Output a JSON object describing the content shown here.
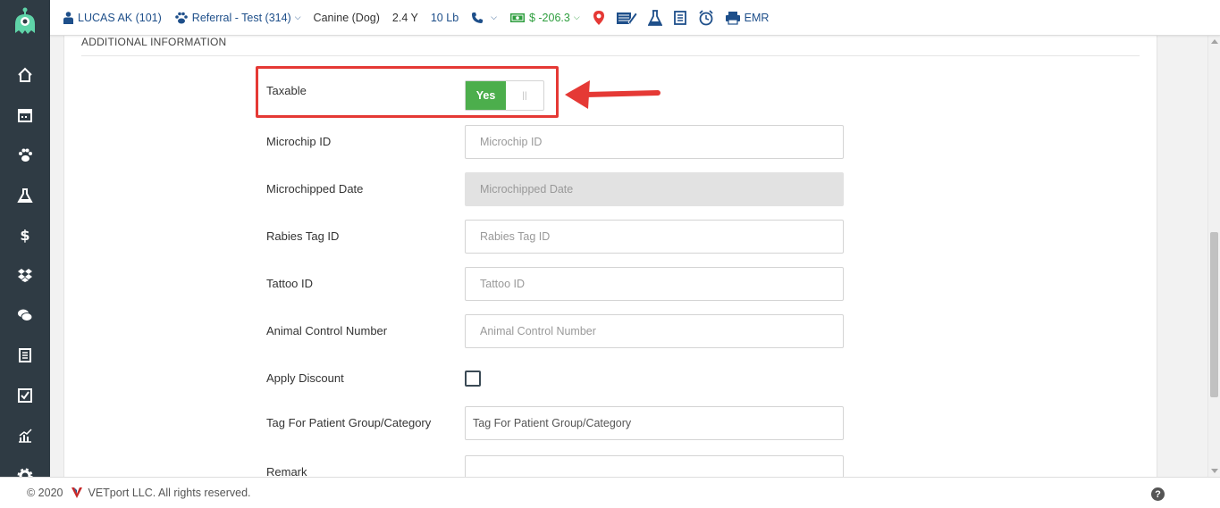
{
  "topbar": {
    "patient": "LUCAS AK (101)",
    "referral": "Referral - Test (314)",
    "species": "Canine (Dog)",
    "age": "2.4 Y",
    "weight": "10 Lb",
    "balance": "$ -206.3",
    "emr": "EMR"
  },
  "section": {
    "title": "ADDITIONAL INFORMATION"
  },
  "form": {
    "taxable": {
      "label": "Taxable",
      "value": "Yes"
    },
    "microchip_id": {
      "label": "Microchip ID",
      "placeholder": "Microchip ID"
    },
    "microchipped_date": {
      "label": "Microchipped Date",
      "placeholder": "Microchipped Date"
    },
    "rabies_tag_id": {
      "label": "Rabies Tag ID",
      "placeholder": "Rabies Tag ID"
    },
    "tattoo_id": {
      "label": "Tattoo ID",
      "placeholder": "Tattoo ID"
    },
    "animal_control_number": {
      "label": "Animal Control Number",
      "placeholder": "Animal Control Number"
    },
    "apply_discount": {
      "label": "Apply Discount",
      "checked": false
    },
    "tag_group": {
      "label": "Tag For Patient Group/Category",
      "placeholder": "Tag For Patient Group/Category"
    },
    "remark": {
      "label": "Remark"
    }
  },
  "footer": {
    "copyright": "© 2020",
    "company": "VETport LLC. All rights reserved.",
    "help": "?"
  },
  "colors": {
    "sidebar": "#2f3b44",
    "link": "#1e4f8a",
    "toggle_on": "#4cae4c",
    "highlight": "#e53935"
  },
  "icons": {
    "sidebar": [
      "home-icon",
      "calendar-icon",
      "paw-icon",
      "flask-icon",
      "dollar-icon",
      "dropbox-icon",
      "chat-icon",
      "invoice-icon",
      "checkbox-icon",
      "chart-icon",
      "gear-icon"
    ]
  }
}
